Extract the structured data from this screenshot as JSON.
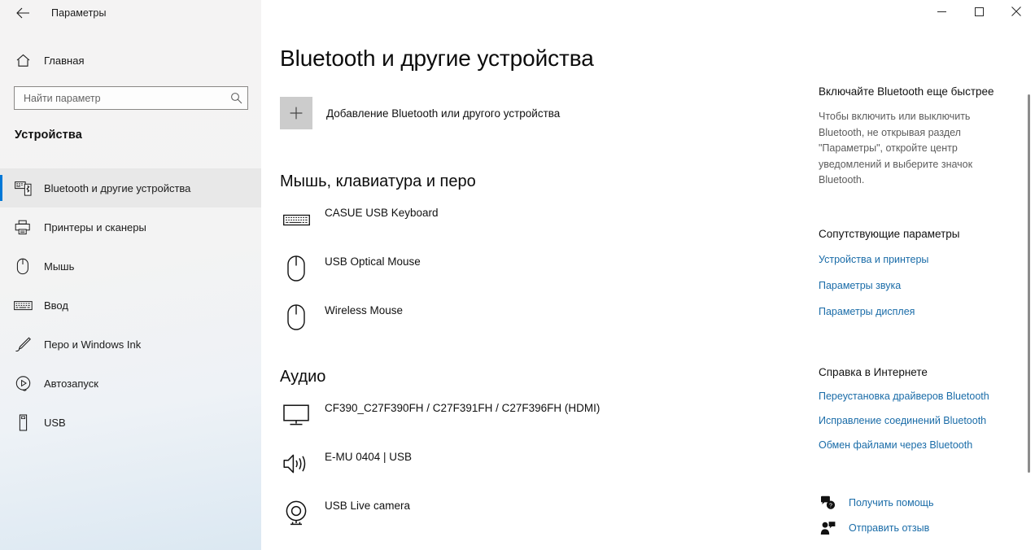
{
  "titlebar": {
    "back_icon": "back-arrow-icon",
    "title": "Параметры",
    "minimize_label": "—",
    "maximize_label": "□",
    "close_label": "✕"
  },
  "sidebar": {
    "home_label": "Главная",
    "home_icon": "home-icon",
    "search": {
      "placeholder": "Найти параметр",
      "value": "",
      "icon": "search-icon"
    },
    "section_heading": "Устройства",
    "items": [
      {
        "label": "Bluetooth и другие устройства",
        "icon": "bluetooth-device-icon",
        "selected": true
      },
      {
        "label": "Принтеры и сканеры",
        "icon": "printer-icon",
        "selected": false
      },
      {
        "label": "Мышь",
        "icon": "mouse-icon",
        "selected": false
      },
      {
        "label": "Ввод",
        "icon": "keyboard-icon",
        "selected": false
      },
      {
        "label": "Перо и Windows Ink",
        "icon": "pen-icon",
        "selected": false
      },
      {
        "label": "Автозапуск",
        "icon": "autoplay-icon",
        "selected": false
      },
      {
        "label": "USB",
        "icon": "usb-icon",
        "selected": false
      }
    ]
  },
  "main": {
    "page_title": "Bluetooth и другие устройства",
    "add_device": {
      "icon": "plus-icon",
      "label": "Добавление Bluetooth или другого устройства"
    },
    "groups": [
      {
        "title": "Мышь, клавиатура и перо",
        "devices": [
          {
            "name": "CASUE USB Keyboard",
            "icon": "keyboard-icon"
          },
          {
            "name": "USB Optical Mouse",
            "icon": "mouse-icon"
          },
          {
            "name": "Wireless Mouse",
            "icon": "mouse-icon"
          }
        ]
      },
      {
        "title": "Аудио",
        "devices": [
          {
            "name": "CF390_C27F390FH / C27F391FH / C27F396FH (HDMI)",
            "icon": "monitor-icon"
          },
          {
            "name": "E-MU 0404 | USB",
            "icon": "speaker-icon"
          },
          {
            "name": "USB Live camera",
            "icon": "camera-icon"
          }
        ]
      }
    ]
  },
  "right_panel": {
    "tip_title": "Включайте Bluetooth еще быстрее",
    "tip_body": "Чтобы включить или выключить Bluetooth, не открывая раздел \"Параметры\", откройте центр уведомлений и выберите значок Bluetooth.",
    "related_title": "Сопутствующие параметры",
    "related_links": [
      "Устройства и принтеры",
      "Параметры звука",
      "Параметры дисплея"
    ],
    "help_title": "Справка в Интернете",
    "help_links": [
      "Переустановка драйверов Bluetooth",
      "Исправление соединений Bluetooth",
      "Обмен файлами через Bluetooth"
    ],
    "actions": [
      {
        "label": "Получить помощь",
        "icon": "help-question-icon"
      },
      {
        "label": "Отправить отзыв",
        "icon": "feedback-person-icon"
      }
    ]
  },
  "colors": {
    "accent": "#0078d7",
    "link": "#1a6ca8",
    "sidebar_bg": "#f3f3f3",
    "plus_box": "#cccccc"
  }
}
